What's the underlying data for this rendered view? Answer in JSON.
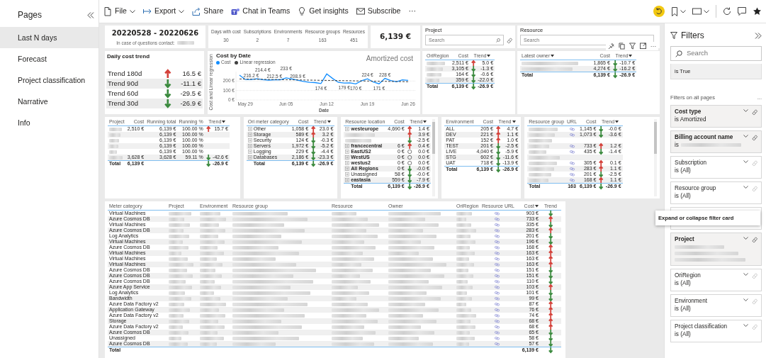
{
  "pages_pane": {
    "title": "Pages",
    "items": [
      {
        "label": "Last N days",
        "selected": true
      },
      {
        "label": "Forecast",
        "selected": false
      },
      {
        "label": "Project classification",
        "selected": false
      },
      {
        "label": "Narrative",
        "selected": false
      },
      {
        "label": "Info",
        "selected": false
      }
    ]
  },
  "toolbar": {
    "items": [
      {
        "kind": "file",
        "label": "File",
        "dropdown": true
      },
      {
        "kind": "export",
        "label": "Export",
        "dropdown": true
      },
      {
        "kind": "share",
        "label": "Share",
        "dropdown": false
      },
      {
        "kind": "teams",
        "label": "Chat in Teams",
        "dropdown": false
      },
      {
        "kind": "insights",
        "label": "Get insights",
        "dropdown": false
      },
      {
        "kind": "subscribe",
        "label": "Subscribe",
        "dropdown": false
      },
      {
        "kind": "more",
        "label": "···",
        "dropdown": false
      }
    ]
  },
  "date_card": {
    "title": "20220528 - 20220626",
    "contact_label": "In case of questions contact:"
  },
  "stats": [
    {
      "label": "Days with cost",
      "value": "30"
    },
    {
      "label": "Subscriptions",
      "value": "2"
    },
    {
      "label": "Environments",
      "value": "7"
    },
    {
      "label": "Resource groups",
      "value": "163"
    },
    {
      "label": "Resources",
      "value": "451"
    }
  ],
  "total_card": {
    "value": "6,139 €"
  },
  "project_slicer": {
    "title": "Project",
    "placeholder": "Search"
  },
  "resource_slicer": {
    "title": "Resource",
    "placeholder": "Search"
  },
  "trend_card": {
    "title": "Daily cost trend",
    "rows": [
      {
        "label": "Trend 180d",
        "kind": "up",
        "value": "16.5 €"
      },
      {
        "label": "Trend 90d",
        "kind": "down",
        "value": "-11.1 €"
      },
      {
        "label": "Trend 60d",
        "kind": "down",
        "value": "-29.5 €"
      },
      {
        "label": "Trend 30d",
        "kind": "down",
        "value": "-26.9 €"
      }
    ]
  },
  "cost_chart": {
    "overlay": "Amortized cost",
    "chart_data": {
      "type": "line",
      "title": "Cost by Date",
      "xlabel": "Date",
      "ylabel": "Cost and Linear regression",
      "categories": [
        null,
        "May 29",
        null,
        null,
        null,
        null,
        null,
        null,
        "Jun 05",
        null,
        null,
        null,
        null,
        null,
        null,
        "Jun 12",
        null,
        null,
        null,
        null,
        null,
        null,
        "Jun 19",
        null,
        null,
        null,
        null,
        null,
        null,
        "Jun 26"
      ],
      "series": [
        {
          "name": "Cost",
          "color": "#118dff",
          "line_style": "solid",
          "values": [
            262,
            216,
            216.2,
            224,
            214.4,
            210,
            212.5,
            214,
            233,
            222,
            208.9,
            196,
            186,
            184,
            174,
            275,
            228,
            186,
            179,
            181,
            170,
            203,
            224,
            190,
            171,
            228,
            205,
            193,
            212,
            207
          ],
          "value_labels": [
            null,
            null,
            "216.2 €",
            null,
            "214.4 €",
            null,
            "212.5 €",
            null,
            "233 €",
            null,
            "208.9 €",
            null,
            null,
            null,
            "174 €",
            null,
            null,
            null,
            "179 €",
            null,
            "170 €",
            null,
            "224 €",
            null,
            "171 €",
            "228 €",
            null,
            null,
            null,
            null
          ]
        },
        {
          "name": "Linear regression",
          "color": "#404040",
          "line_style": "dashed",
          "values": [
            222,
            221,
            220,
            219,
            218,
            217,
            216,
            215,
            214,
            213,
            212,
            211,
            210,
            209,
            208,
            207,
            206,
            205,
            204,
            203,
            202,
            201,
            200,
            199,
            198,
            197,
            196,
            195,
            194,
            193
          ]
        }
      ],
      "ylim": [
        0,
        300
      ],
      "yticks": [
        {
          "value": 0,
          "label": "0 €"
        },
        {
          "value": 100,
          "label": "100 €"
        },
        {
          "value": 200,
          "label": "200 €"
        }
      ]
    }
  },
  "tables": {
    "region_table": {
      "columns": [
        {
          "label": "OriRegion",
          "kind": "name",
          "sorted": false
        },
        {
          "label": "Cost",
          "kind": "cost",
          "sorted": false
        },
        {
          "label": "Trend",
          "kind": "trend",
          "sorted": true
        }
      ],
      "rows": [
        {
          "redacted": true,
          "cost": "2,511 €",
          "trend": {
            "kind": "up",
            "value": "5.0 €"
          }
        },
        {
          "redacted": true,
          "cost": "3,105 €",
          "trend": {
            "kind": "down",
            "value": "-1.3 €"
          }
        },
        {
          "redacted": true,
          "cost": "164 €",
          "trend": {
            "kind": "down",
            "value": "-0.6 €"
          }
        },
        {
          "redacted": true,
          "cost": "359 €",
          "trend": {
            "kind": "down",
            "value": "-22.0 €"
          }
        },
        {
          "total": true,
          "name": "Total",
          "cost": "6,139 €",
          "trend": {
            "kind": "down",
            "value": "-26.9 €"
          }
        }
      ]
    },
    "owner_table": {
      "columns": [
        {
          "label": "Latest owner",
          "kind": "name",
          "sorted": true
        },
        {
          "label": "Cost",
          "kind": "cost",
          "sorted": false
        },
        {
          "label": "Trend",
          "kind": "trend",
          "sorted": true
        }
      ],
      "rows": [
        {
          "redacted": true,
          "cost": "1,865 €",
          "trend": {
            "kind": "down",
            "value": "-10.7 €"
          }
        },
        {
          "redacted": true,
          "cost": "4,274 €",
          "trend": {
            "kind": "down",
            "value": "-16.2 €"
          }
        },
        {
          "total": true,
          "name": "Total",
          "cost": "6,139 €",
          "trend": {
            "kind": "down",
            "value": "-26.9 €"
          }
        }
      ]
    },
    "project_table": {
      "columns": [
        {
          "label": "Project",
          "kind": "name",
          "sorted": false
        },
        {
          "label": "Cost",
          "kind": "cost",
          "sorted": false
        },
        {
          "label": "Running total",
          "kind": "running_total",
          "sorted": false
        },
        {
          "label": "Running %",
          "kind": "running_pct",
          "sorted": false
        },
        {
          "label": "Trend",
          "kind": "trend",
          "sorted": true
        }
      ],
      "rows": [
        {
          "redacted": true,
          "cost": "2,510 €",
          "running_total": "6,139 €",
          "running_pct": "100.00 %",
          "trend": {
            "kind": "up",
            "value": "15.7 €"
          }
        },
        {
          "redacted": true,
          "running_total": "6,139 €",
          "running_pct": "100.00 %"
        },
        {
          "redacted": true,
          "running_total": "6,139 €",
          "running_pct": "100.00 %"
        },
        {
          "redacted": true,
          "running_total": "6,139 €",
          "running_pct": "100.00 %"
        },
        {
          "redacted": true,
          "running_total": "6,139 €",
          "running_pct": "100.00 %"
        },
        {
          "redacted": true,
          "cost": "3,628 €",
          "running_total": "3,628 €",
          "running_pct": "59.11 %",
          "trend": {
            "kind": "down",
            "value": "-42.6 €"
          }
        },
        {
          "total": true,
          "name": "Total",
          "cost": "6,139 €",
          "trend": {
            "kind": "down",
            "value": "-26.9 €"
          }
        }
      ]
    },
    "meter_table": {
      "columns": [
        {
          "label": "Ori meter category",
          "kind": "name",
          "sorted": false
        },
        {
          "label": "Cost",
          "kind": "cost",
          "sorted": false
        },
        {
          "label": "Trend",
          "kind": "trend",
          "sorted": true
        }
      ],
      "rows": [
        {
          "name": "Other",
          "expandable": true,
          "cost": "1,058 €",
          "trend": {
            "kind": "up",
            "value": "23.0 €"
          }
        },
        {
          "name": "Storage",
          "expandable": true,
          "cost": "589 €",
          "trend": {
            "kind": "up",
            "value": "3.2 €"
          }
        },
        {
          "name": "Security",
          "expandable": true,
          "cost": "124 €",
          "trend": {
            "kind": "down",
            "value": "-0.3 €"
          }
        },
        {
          "name": "Servers",
          "expandable": true,
          "cost": "1,972 €",
          "trend": {
            "kind": "down",
            "value": "-5.2 €"
          }
        },
        {
          "name": "Logging",
          "expandable": true,
          "cost": "229 €",
          "trend": {
            "kind": "down",
            "value": "-4.4 €"
          }
        },
        {
          "name": "Databases",
          "expandable": true,
          "cost": "2,186 €",
          "trend": {
            "kind": "down",
            "value": "-23.3 €"
          }
        },
        {
          "total": true,
          "name": "Total",
          "cost": "6,139 €",
          "trend": {
            "kind": "down",
            "value": "-26.9 €"
          }
        }
      ]
    },
    "location_table": {
      "columns": [
        {
          "label": "Resource location",
          "kind": "name",
          "sorted": false
        },
        {
          "label": "Cost",
          "kind": "cost",
          "sorted": false
        },
        {
          "label": "Trend",
          "kind": "trend",
          "sorted": true
        }
      ],
      "rows": [
        {
          "name": "westeurope",
          "expandable": true,
          "bold": true,
          "cost": "4,690 €",
          "trend": {
            "kind": "up",
            "value": "1.4 €"
          }
        },
        {
          "redacted": true,
          "trend": {
            "kind": "up",
            "value": "3.9 €"
          }
        },
        {
          "redacted": true,
          "trend": {
            "kind": "down",
            "value": "-2.5 €"
          }
        },
        {
          "name": "francecentral",
          "expandable": true,
          "bold": true,
          "cost": "6 €",
          "trend": {
            "kind": "up",
            "value": "0.4 €"
          }
        },
        {
          "name": "EastUS2",
          "expandable": true,
          "bold": true,
          "cost": "0 €",
          "trend": {
            "kind": "flat",
            "value": "0.0 €"
          }
        },
        {
          "name": "WestUS",
          "expandable": true,
          "bold": true,
          "cost": "0 €",
          "trend": {
            "kind": "flat",
            "value": "0.0 €"
          }
        },
        {
          "name": "westus2",
          "expandable": true,
          "bold": true,
          "cost": "0 €",
          "trend": {
            "kind": "flat",
            "value": "0.0 €"
          }
        },
        {
          "name": "All Regions",
          "expandable": true,
          "bold": true,
          "cost": "0 €",
          "trend": {
            "kind": "down",
            "value": "-0.0 €"
          }
        },
        {
          "name": "Unassigned",
          "expandable": true,
          "bold": false,
          "cost": "58 €",
          "trend": {
            "kind": "down",
            "value": "-0.0 €"
          }
        },
        {
          "name": "eastasia",
          "expandable": true,
          "bold": true,
          "cost": "559 €",
          "trend": {
            "kind": "down",
            "value": "-7.9 €"
          }
        },
        {
          "total": true,
          "name": "Total",
          "cost": "6,139 €",
          "trend": {
            "kind": "down",
            "value": "-26.9 €"
          }
        }
      ]
    },
    "environment_table": {
      "columns": [
        {
          "label": "Environment",
          "kind": "name",
          "sorted": false
        },
        {
          "label": "Cost",
          "kind": "cost",
          "sorted": false
        },
        {
          "label": "Trend",
          "kind": "trend",
          "sorted": true
        }
      ],
      "rows": [
        {
          "name": "ALL",
          "cost": "205 €",
          "trend": {
            "kind": "up",
            "value": "4.7 €"
          }
        },
        {
          "name": "DEV",
          "cost": "221 €",
          "trend": {
            "kind": "up",
            "value": "1.1 €"
          }
        },
        {
          "name": "PAT",
          "cost": "152 €",
          "trend": {
            "kind": "up",
            "value": "1.0 €"
          }
        },
        {
          "name": "TEST",
          "cost": "201 €",
          "trend": {
            "kind": "down",
            "value": "-2.5 €"
          }
        },
        {
          "name": "LIVE",
          "cost": "4,040 €",
          "trend": {
            "kind": "down",
            "value": "-5.9 €"
          }
        },
        {
          "name": "STG",
          "cost": "602 €",
          "trend": {
            "kind": "down",
            "value": "-11.6 €"
          }
        },
        {
          "name": "UAT",
          "cost": "718 €",
          "trend": {
            "kind": "down",
            "value": "-13.9 €"
          }
        },
        {
          "total": true,
          "name": "Total",
          "cost": "6,139 €",
          "trend": {
            "kind": "down",
            "value": "-26.9 €"
          }
        }
      ]
    },
    "resource_group_table": {
      "columns": [
        {
          "label": "Resource group",
          "kind": "name",
          "sorted": false
        },
        {
          "label": "URL",
          "kind": "link",
          "sorted": false
        },
        {
          "label": "Cost",
          "kind": "cost",
          "sorted": false
        },
        {
          "label": "Trend",
          "kind": "trend",
          "sorted": true
        }
      ],
      "rows": [
        {
          "redacted": true,
          "link": true,
          "cost": "1,145 €",
          "trend": {
            "kind": "down",
            "value": "-0.0 €"
          }
        },
        {
          "redacted": true,
          "link": true,
          "cost": "1,073 €",
          "trend": {
            "kind": "down",
            "value": "-3.6 €"
          }
        },
        {
          "redacted": true,
          "link": false
        },
        {
          "redacted": true,
          "link": true,
          "cost": "733 €",
          "trend": {
            "kind": "up",
            "value": "1.2 €"
          }
        },
        {
          "redacted": true,
          "link": true,
          "cost": "435 €",
          "trend": {
            "kind": "down",
            "value": "-1.4 €"
          }
        },
        {
          "redacted": true,
          "link": false
        },
        {
          "redacted": true,
          "link": true,
          "cost": "305 €",
          "trend": {
            "kind": "up",
            "value": "0.1 €"
          }
        },
        {
          "redacted": true,
          "link": true,
          "cost": "283 €",
          "trend": {
            "kind": "up",
            "value": "1.1 €"
          }
        },
        {
          "redacted": true,
          "link": true,
          "cost": "201 €",
          "trend": {
            "kind": "down",
            "value": "-2.5 €"
          }
        },
        {
          "redacted": true,
          "link": true,
          "cost": "168 €",
          "trend": {
            "kind": "up",
            "value": "1.1 €"
          }
        },
        {
          "total": true,
          "name": "Total",
          "link_text": "163",
          "cost": "6,139 €",
          "trend": {
            "kind": "down",
            "value": "-26.9 €"
          }
        }
      ]
    },
    "detail_table": {
      "columns": [
        {
          "label": "Meter category",
          "kind": "name",
          "sorted": false
        },
        {
          "label": "Project",
          "kind": "redacted",
          "sorted": false
        },
        {
          "label": "Environment",
          "kind": "redacted",
          "sorted": false
        },
        {
          "label": "Resource group",
          "kind": "redacted",
          "sorted": false
        },
        {
          "label": "Resource",
          "kind": "redacted",
          "sorted": false
        },
        {
          "label": "Owner",
          "kind": "redacted",
          "sorted": false
        },
        {
          "label": "OriRegion",
          "kind": "redacted",
          "sorted": false
        },
        {
          "label": "Resource URL",
          "kind": "link",
          "sorted": false
        },
        {
          "label": "Cost",
          "kind": "cost",
          "sorted": true
        },
        {
          "label": "Trend",
          "kind": "trend",
          "sorted": false
        }
      ],
      "rows": [
        {
          "name": "Virtual Machines",
          "link": true,
          "cost": "903 €",
          "trend": {
            "kind": "down"
          }
        },
        {
          "name": "Azure Cosmos DB",
          "link": true,
          "cost": "733 €",
          "trend": {
            "kind": "up"
          }
        },
        {
          "name": "Virtual Machines",
          "link": true,
          "cost": "335 €",
          "trend": {
            "kind": "down"
          }
        },
        {
          "name": "Azure Cosmos DB",
          "link": true,
          "cost": "283 €",
          "trend": {
            "kind": "up"
          }
        },
        {
          "name": "Log Analytics",
          "link": true,
          "cost": "201 €",
          "trend": {
            "kind": "down"
          }
        },
        {
          "name": "Virtual Machines",
          "link": true,
          "cost": "196 €",
          "trend": {
            "kind": "down"
          }
        },
        {
          "name": "Azure Cosmos DB",
          "link": true,
          "cost": "168 €",
          "trend": {
            "kind": "up"
          }
        },
        {
          "name": "Virtual Machines",
          "link": true,
          "cost": "163 €",
          "trend": {
            "kind": "up"
          }
        },
        {
          "name": "Virtual Machines",
          "link": true,
          "cost": "163 €",
          "trend": {
            "kind": "up"
          }
        },
        {
          "name": "Virtual Machines",
          "link": true,
          "cost": "163 €",
          "trend": {
            "kind": "up"
          }
        },
        {
          "name": "Azure Cosmos DB",
          "link": true,
          "cost": "151 €",
          "trend": {
            "kind": "down"
          }
        },
        {
          "name": "Azure Cosmos DB",
          "link": true,
          "cost": "151 €",
          "trend": {
            "kind": "down"
          }
        },
        {
          "name": "Azure Cosmos DB",
          "link": true,
          "cost": "110 €",
          "trend": {
            "kind": "down"
          }
        },
        {
          "name": "Azure App Service",
          "link": true,
          "cost": "103 €",
          "trend": {
            "kind": "up"
          }
        },
        {
          "name": "Log Analytics",
          "link": true,
          "cost": "101 €",
          "trend": {
            "kind": "down"
          }
        },
        {
          "name": "Bandwidth",
          "link": true,
          "cost": "99 €",
          "trend": {
            "kind": "down"
          }
        },
        {
          "name": "Azure Data Factory v2",
          "link": true,
          "cost": "87 €",
          "trend": {
            "kind": "up"
          }
        },
        {
          "name": "Application Gateway",
          "link": true,
          "cost": "76 €",
          "trend": {
            "kind": "up"
          }
        },
        {
          "name": "Azure Data Factory v2",
          "link": true,
          "cost": "74 €",
          "trend": {
            "kind": "up"
          }
        },
        {
          "name": "Storage",
          "link": true,
          "cost": "68 €",
          "trend": {
            "kind": "up"
          }
        },
        {
          "name": "Azure Data Factory v2",
          "link": true,
          "cost": "68 €",
          "trend": {
            "kind": "up"
          }
        },
        {
          "name": "Azure Cosmos DB",
          "link": true,
          "cost": "65 €",
          "trend": {
            "kind": "down"
          }
        },
        {
          "name": "Unassigned",
          "link": true,
          "cost": "58 €",
          "trend": {
            "kind": "down"
          }
        },
        {
          "name": "Azure Cosmos DB",
          "link": true,
          "cost": "57 €",
          "trend": {
            "kind": "down"
          }
        },
        {
          "total": true,
          "name": "Total",
          "cost": "6,139 €",
          "trend": {
            "kind": "down"
          }
        }
      ]
    }
  },
  "filters": {
    "title": "Filters",
    "search_placeholder": "Search",
    "page_filter_value": "is True",
    "section_label": "Filters on all pages",
    "section_more": "...",
    "tooltip": "Expand or collapse filter card",
    "cards": [
      {
        "name": "Cost type",
        "value": "is Amortized",
        "applied": true,
        "redacted": false,
        "covered": false
      },
      {
        "name": "Billing account name",
        "value": "is",
        "applied": true,
        "redacted": true,
        "covered": false
      },
      {
        "name": "Subscription",
        "value": "is (All)",
        "applied": false,
        "redacted": false,
        "covered": false
      },
      {
        "name": "Resource group",
        "value": "is (All)",
        "applied": false,
        "redacted": false,
        "covered": false
      },
      {
        "applied": false,
        "redacted": false,
        "covered": true
      },
      {
        "name": "Project",
        "applied": true,
        "redacted": true,
        "covered": false
      },
      {
        "name": "OriRegion",
        "value": "is (All)",
        "applied": false,
        "redacted": false,
        "covered": false
      },
      {
        "name": "Environment",
        "value": "is (All)",
        "applied": false,
        "redacted": false,
        "covered": false
      },
      {
        "name": "Project classification",
        "value": "is (All)",
        "applied": false,
        "redacted": false,
        "covered": false
      }
    ]
  }
}
